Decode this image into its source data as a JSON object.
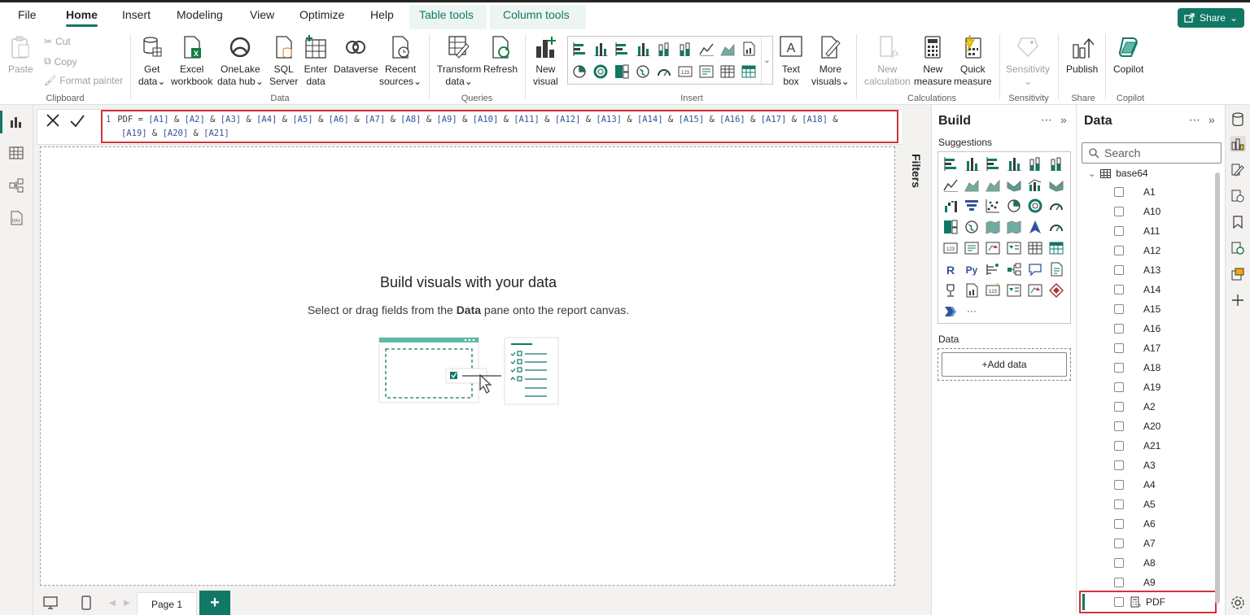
{
  "tabs": {
    "file": "File",
    "home": "Home",
    "insert": "Insert",
    "modeling": "Modeling",
    "view": "View",
    "optimize": "Optimize",
    "help": "Help",
    "table_tools": "Table tools",
    "column_tools": "Column tools"
  },
  "share_label": "Share",
  "ribbon": {
    "clipboard": {
      "paste": "Paste",
      "cut": "Cut",
      "copy": "Copy",
      "format_painter": "Format painter",
      "label": "Clipboard"
    },
    "data": {
      "get_data_1": "Get",
      "get_data_2": "data",
      "excel_1": "Excel",
      "excel_2": "workbook",
      "onelake_1": "OneLake",
      "onelake_2": "data hub",
      "sql_1": "SQL",
      "sql_2": "Server",
      "enter_1": "Enter",
      "enter_2": "data",
      "dataverse": "Dataverse",
      "recent_1": "Recent",
      "recent_2": "sources",
      "label": "Data"
    },
    "queries": {
      "transform_1": "Transform",
      "transform_2": "data",
      "refresh": "Refresh",
      "label": "Queries"
    },
    "insert": {
      "new_visual_1": "New",
      "new_visual_2": "visual",
      "text_box_1": "Text",
      "text_box_2": "box",
      "more_visuals_1": "More",
      "more_visuals_2": "visuals",
      "label": "Insert"
    },
    "calculations": {
      "new_calc_1": "New",
      "new_calc_2": "calculation",
      "new_measure_1": "New",
      "new_measure_2": "measure",
      "quick_measure_1": "Quick",
      "quick_measure_2": "measure",
      "label": "Calculations"
    },
    "sensitivity": {
      "button": "Sensitivity",
      "label": "Sensitivity"
    },
    "share": {
      "publish": "Publish",
      "label": "Share"
    },
    "copilot": {
      "button": "Copilot",
      "label": "Copilot"
    }
  },
  "formula": {
    "line_number": "1",
    "prefix": "PDF = ",
    "line1_refs": [
      "[A1]",
      "[A2]",
      "[A3]",
      "[A4]",
      "[A5]",
      "[A6]",
      "[A7]",
      "[A8]",
      "[A9]",
      "[A10]",
      "[A11]",
      "[A12]",
      "[A13]",
      "[A14]",
      "[A15]",
      "[A16]",
      "[A17]",
      "[A18]"
    ],
    "line2_refs": [
      "[A19]",
      "[A20]",
      "[A21]"
    ],
    "joiner": " & "
  },
  "canvas": {
    "title": "Build visuals with your data",
    "sub_before": "Select or drag fields from the ",
    "sub_bold": "Data",
    "sub_after": " pane onto the report canvas."
  },
  "filters_label": "Filters",
  "build": {
    "title": "Build",
    "suggestions": "Suggestions",
    "data_label": "Data",
    "add_data": "+Add data"
  },
  "data_pane": {
    "title": "Data",
    "search_placeholder": "Search",
    "table_name": "base64",
    "fields": [
      "A1",
      "A10",
      "A11",
      "A12",
      "A13",
      "A14",
      "A15",
      "A16",
      "A17",
      "A18",
      "A19",
      "A2",
      "A20",
      "A21",
      "A3",
      "A4",
      "A5",
      "A6",
      "A7",
      "A8",
      "A9"
    ],
    "measure": "PDF"
  },
  "bottom": {
    "page_tab": "Page 1",
    "add_page": "+"
  },
  "colors": {
    "accent": "#117865",
    "highlight": "#d13438"
  }
}
